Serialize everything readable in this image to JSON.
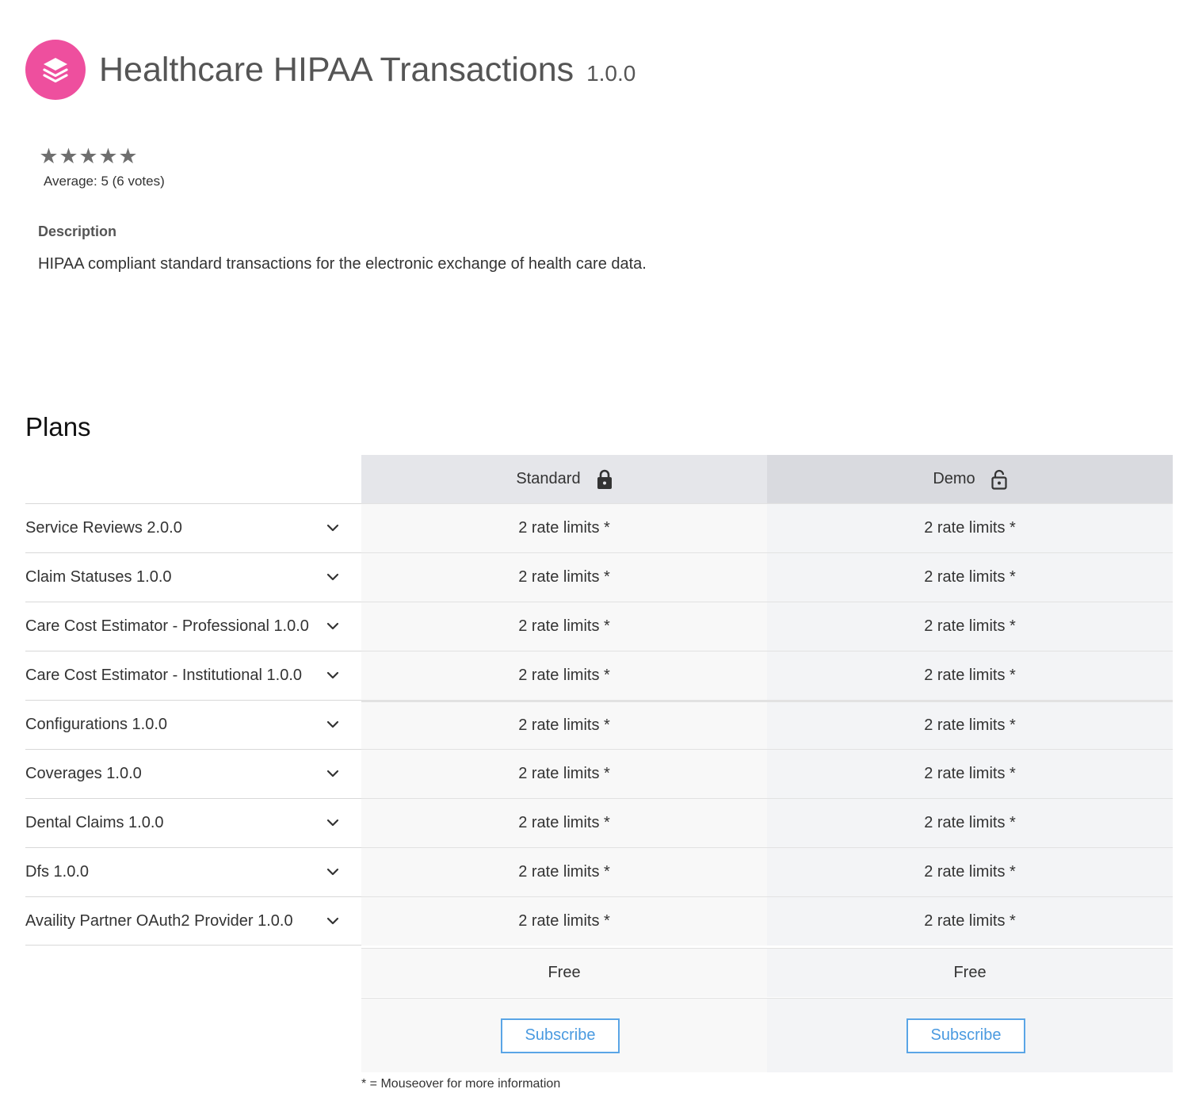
{
  "header": {
    "title": "Healthcare HIPAA Transactions",
    "version": "1.0.0",
    "logo_icon": "layers-icon",
    "logo_color": "#ee4f9e"
  },
  "rating": {
    "value": 5,
    "max": 5,
    "average_text": "Average: 5 (6 votes)"
  },
  "description": {
    "label": "Description",
    "text": "HIPAA compliant standard transactions for the electronic exchange of health care data."
  },
  "plans": {
    "heading": "Plans",
    "columns": [
      {
        "name": "Standard",
        "lock_icon": "lock-closed-icon"
      },
      {
        "name": "Demo",
        "lock_icon": "lock-open-icon"
      }
    ],
    "rows": [
      {
        "label": "Service Reviews 2.0.0",
        "standard": "2 rate limits *",
        "demo": "2 rate limits *"
      },
      {
        "label": "Claim Statuses 1.0.0",
        "standard": "2 rate limits *",
        "demo": "2 rate limits *"
      },
      {
        "label": "Care Cost Estimator - Professional 1.0.0",
        "standard": "2 rate limits *",
        "demo": "2 rate limits *"
      },
      {
        "label": "Care Cost Estimator - Institutional 1.0.0",
        "standard": "2 rate limits *",
        "demo": "2 rate limits *"
      },
      {
        "label": "Configurations 1.0.0",
        "standard": "2 rate limits *",
        "demo": "2 rate limits *"
      },
      {
        "label": "Coverages 1.0.0",
        "standard": "2 rate limits *",
        "demo": "2 rate limits *"
      },
      {
        "label": "Dental Claims 1.0.0",
        "standard": "2 rate limits *",
        "demo": "2 rate limits *"
      },
      {
        "label": "Dfs 1.0.0",
        "standard": "2 rate limits *",
        "demo": "2 rate limits *"
      },
      {
        "label": "Availity Partner OAuth2 Provider 1.0.0",
        "standard": "2 rate limits *",
        "demo": "2 rate limits *"
      }
    ],
    "price": {
      "standard": "Free",
      "demo": "Free"
    },
    "subscribe_label": "Subscribe",
    "subscribe_color": "#4a9ae0",
    "footnote": "* = Mouseover for more information"
  }
}
